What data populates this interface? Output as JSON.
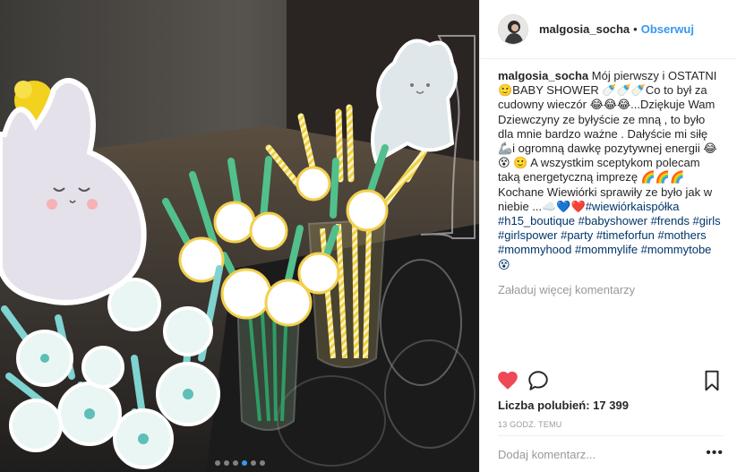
{
  "post": {
    "username": "malgosia_socha",
    "separator": "•",
    "follow_label": "Obserwuj",
    "caption_text": "Mój pierwszy i OSTATNI 🙂BABY SHOWER 🍼🍼🍼Co to był za cudowny wieczór 😂😂😂...Dziękuje Wam Dziewczyny ze byłyście ze mną , to było dla mnie bardzo ważne . Dałyście mi siłę 🦾i ogromną dawkę pozytywnej energii 😂😵 🙂 A wszystkim sceptykom polecam taką energetyczną imprezę 🌈🌈🌈 Kochane Wiewiórki sprawiły ze było jak w niebie ...☁️💙❤️",
    "caption_tags": "#wiewiórkaispółka #h15_boutique #babyshower #frends #girls #girlspower #party #timeforfun #mothers #mommyhood #mommylife #mommytobe 😵",
    "load_more_label": "Załaduj więcej komentarzy",
    "likes_label": "Liczba polubień: 17 399",
    "time_label": "13 GODZ. TEMU",
    "comment_placeholder": "Dodaj komentarz...",
    "more_label": "•••",
    "carousel": {
      "count": 6,
      "active": 3
    }
  },
  "icons": {
    "like": "heart-icon",
    "comment": "comment-bubble-icon",
    "save": "bookmark-icon",
    "more": "more-options-icon"
  },
  "colors": {
    "link": "#3897f0",
    "hashtag": "#003569",
    "heart": "#ed4956",
    "muted": "#999999",
    "text": "#262626",
    "straw_green": "#4fbf8b",
    "straw_yellow": "#f5d547"
  }
}
